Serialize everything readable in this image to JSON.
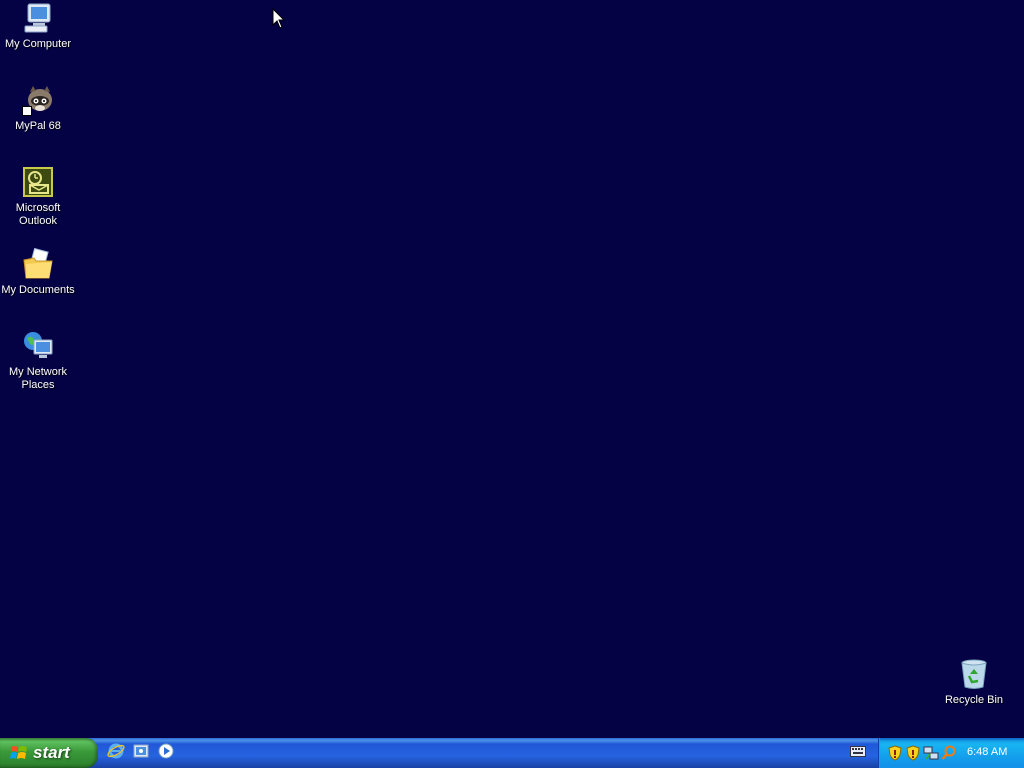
{
  "desktop": {
    "background_color": "#040244",
    "icons": [
      {
        "label": "My Computer",
        "icon": "my-computer-icon"
      },
      {
        "label": "MyPal 68",
        "icon": "mypal-raccoon-icon"
      },
      {
        "label": "Microsoft Outlook",
        "icon": "outlook-icon"
      },
      {
        "label": "My Documents",
        "icon": "my-documents-folder-icon"
      },
      {
        "label": "My Network Places",
        "icon": "network-places-icon"
      },
      {
        "label": "Recycle Bin",
        "icon": "recycle-bin-icon"
      }
    ]
  },
  "taskbar": {
    "start_label": "start",
    "quick_launch": [
      {
        "icon": "internet-explorer-icon"
      },
      {
        "icon": "show-desktop-icon"
      },
      {
        "icon": "media-player-icon"
      }
    ],
    "language_indicator_icon": "keyboard-icon",
    "tray": {
      "icons": [
        "security-shield-icon",
        "security-shield-icon",
        "network-icon",
        "search-icon"
      ],
      "clock": "6:48 AM"
    }
  }
}
